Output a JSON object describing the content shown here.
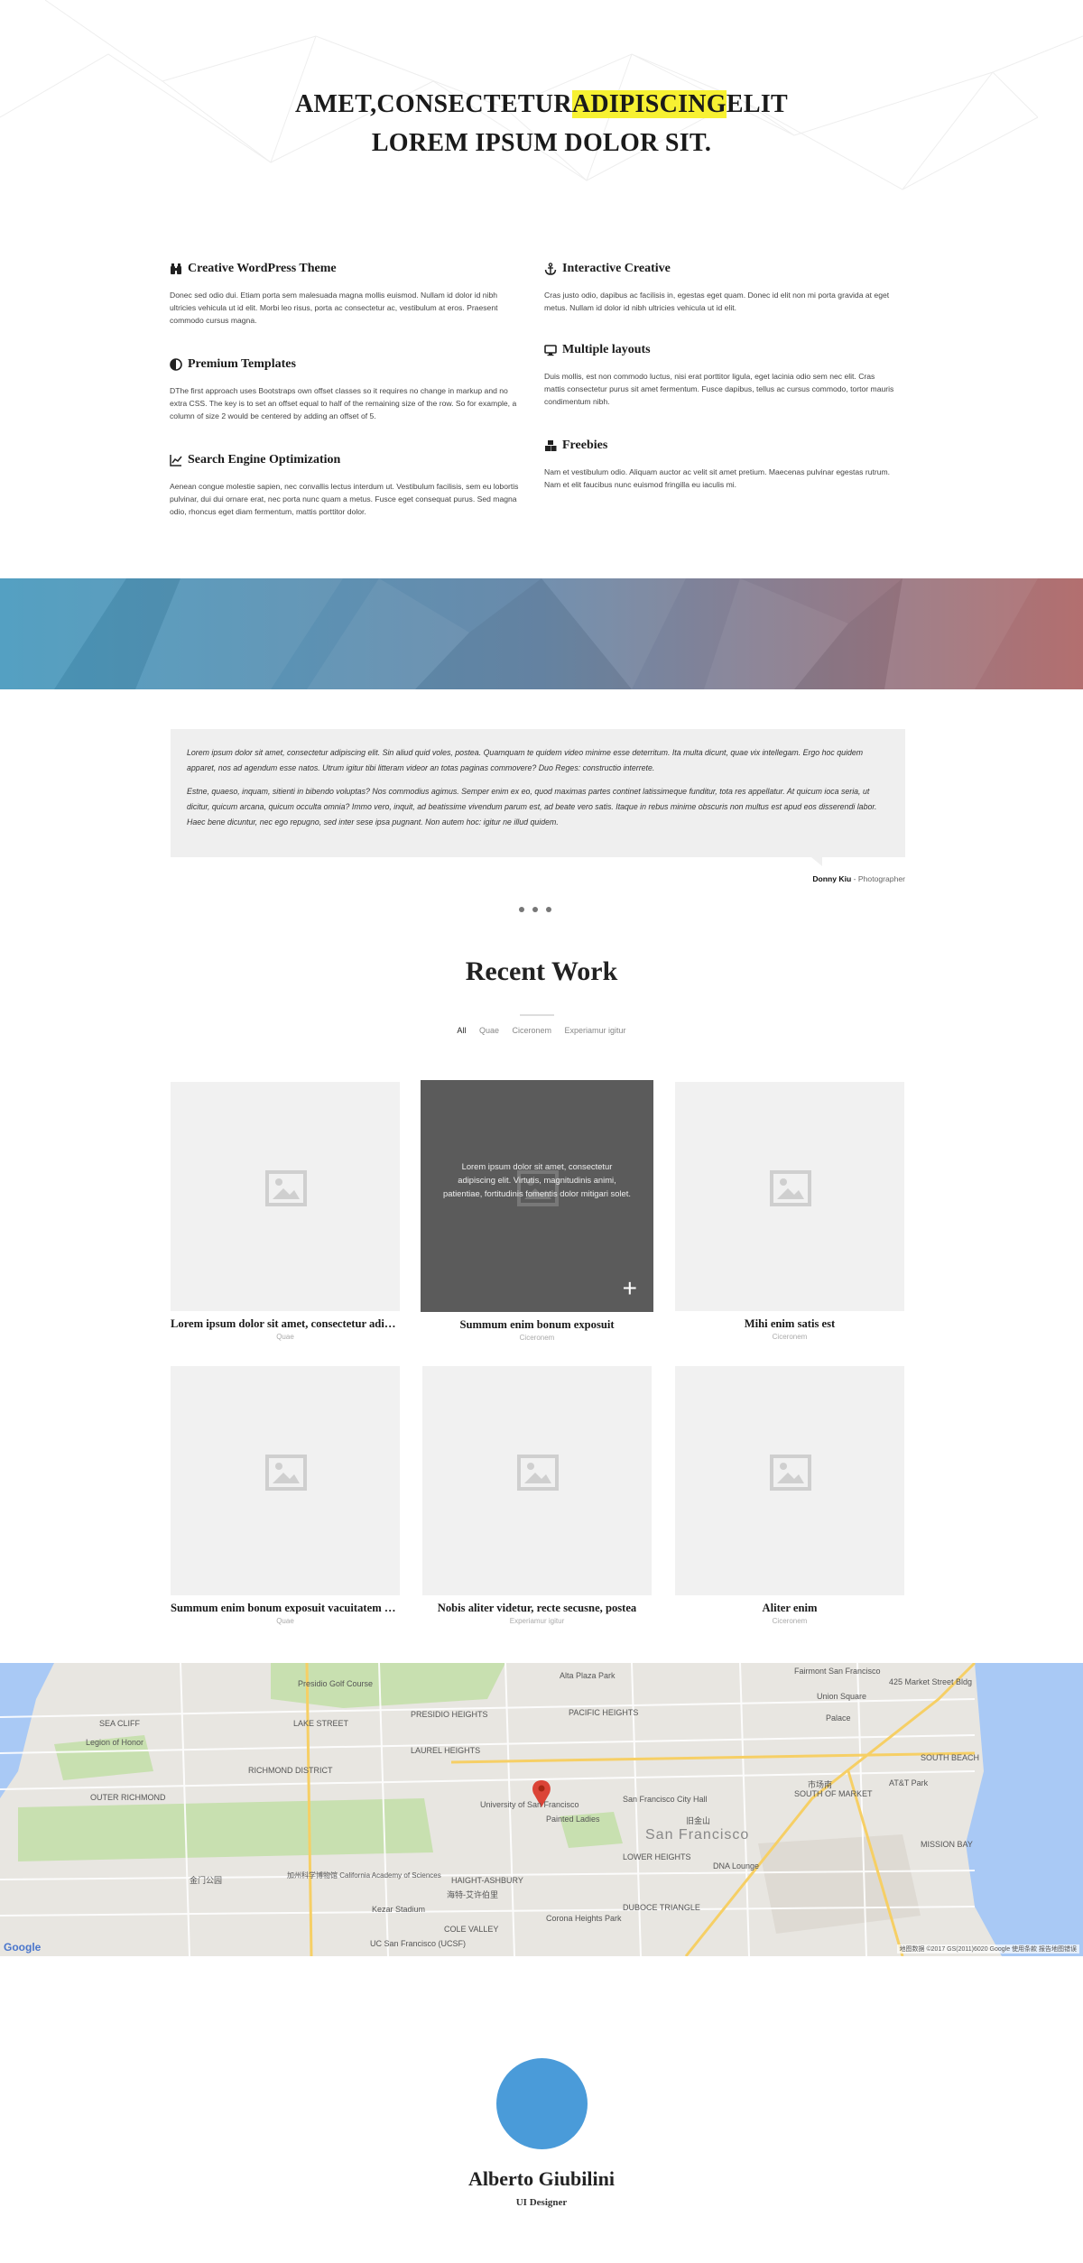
{
  "hero": {
    "line1_pre": "AMET,CONSECTETUR",
    "line1_highlight": "ADIPISCING",
    "line1_post": "ELIT",
    "line2": "LOREM IPSUM DOLOR SIT."
  },
  "features": [
    {
      "icon": "binoculars-icon",
      "title": "Creative WordPress Theme",
      "text": "Donec sed odio dui. Etiam porta sem malesuada magna mollis euismod. Nullam id dolor id nibh ultricies vehicula ut id elit. Morbi leo risus, porta ac consectetur ac, vestibulum at eros. Praesent commodo cursus magna."
    },
    {
      "icon": "adjust-icon",
      "title": "Premium Templates",
      "text": "DThe first approach uses Bootstraps own offset classes so it requires no change in markup and no extra CSS. The key is to set an offset equal to half of the remaining size of the row. So for example, a column of size 2 would be centered by adding an offset of 5."
    },
    {
      "icon": "line-chart-icon",
      "title": "Search Engine Optimization",
      "text": "Aenean congue molestie sapien, nec convallis lectus interdum ut. Vestibulum facilisis, sem eu lobortis pulvinar, dui dui ornare erat, nec porta nunc quam a metus. Fusce eget consequat purus. Sed magna odio, rhoncus eget diam fermentum, mattis porttitor dolor."
    },
    {
      "icon": "anchor-icon",
      "title": "Interactive Creative",
      "text": "Cras justo odio, dapibus ac facilisis in, egestas eget quam. Donec id elit non mi porta gravida at eget metus. Nullam id dolor id nibh ultricies vehicula ut id elit."
    },
    {
      "icon": "desktop-icon",
      "title": "Multiple layouts",
      "text": "Duis mollis, est non commodo luctus, nisi erat porttitor ligula, eget lacinia odio sem nec elit. Cras mattis consectetur purus sit amet fermentum. Fusce dapibus, tellus ac cursus commodo, tortor mauris condimentum nibh."
    },
    {
      "icon": "cubes-icon",
      "title": "Freebies",
      "text": "Nam et vestibulum odio. Aliquam auctor ac velit sit amet pretium. Maecenas pulvinar egestas rutrum. Nam et elit faucibus nunc euismod fringilla eu iaculis mi."
    }
  ],
  "testimonial": {
    "p1": "Lorem ipsum dolor sit amet, consectetur adipiscing elit. Sin aliud quid voles, postea. Quamquam te quidem video minime esse deterritum. Ita multa dicunt, quae vix intellegam. Ergo hoc quidem apparet, nos ad agendum esse natos. Utrum igitur tibi litteram videor an totas paginas commovere? Duo Reges: constructio interrete.",
    "p2": "Estne, quaeso, inquam, sitienti in bibendo voluptas? Nos commodius agimus. Semper enim ex eo, quod maximas partes continet latissimeque funditur, tota res appellatur. At quicum ioca seria, ut dicitur, quicum arcana, quicum occulta omnia? Immo vero, inquit, ad beatissime vivendum parum est, ad beate vero satis. Itaque in rebus minime obscuris non multus est apud eos disserendi labor. Haec bene dicuntur, nec ego repugno, sed inter sese ipsa pugnant. Non autem hoc: igitur ne illud quidem.",
    "author": "Donny Kiu",
    "role": " - Photographer"
  },
  "recent_work": {
    "title": "Recent Work",
    "filters": [
      "All",
      "Quae",
      "Ciceronem",
      "Experiamur igitur"
    ],
    "items": [
      {
        "title": "Lorem ipsum dolor sit amet, consectetur adipiscing",
        "category": "Quae"
      },
      {
        "title": "Summum enim bonum exposuit",
        "category": "Ciceronem",
        "overlay": "Lorem ipsum dolor sit amet, consectetur adipiscing elit. Virtutis, magnitudinis animi, patientiae, fortitudinis fomentis dolor mitigari solet.",
        "plus": "+"
      },
      {
        "title": "Mihi enim satis est",
        "category": "Ciceronem"
      },
      {
        "title": "Summum enim bonum exposuit vacuitatem doloris",
        "category": "Quae"
      },
      {
        "title": "Nobis aliter videtur, recte secusne, postea",
        "category": "Experiamur igitur"
      },
      {
        "title": "Aliter enim",
        "category": "Ciceronem"
      }
    ]
  },
  "map": {
    "labels": [
      "Presidio Golf Course",
      "SEA CLIFF",
      "Legion of Honor",
      "LAKE STREET",
      "RICHMOND DISTRICT",
      "OUTER RICHMOND",
      "PRESIDIO HEIGHTS",
      "LAUREL HEIGHTS",
      "PACIFIC HEIGHTS",
      "Alta Plaza Park",
      "University of San Francisco",
      "Painted Ladies",
      "San Francisco City Hall",
      "HAIGHT-ASHBURY",
      "Kezar Stadium",
      "COLE VALLEY",
      "LOWER HEIGHTS",
      "DUBOCE TRIANGLE",
      "Corona Heights Park",
      "DNA Lounge",
      "SOUTH OF MARKET",
      "AT&T Park",
      "MISSION BAY",
      "SOUTH BEACH",
      "Union Square",
      "Palace",
      "Fairmont San Francisco",
      "425 Market Street Bldg",
      "UC San Francisco (UCSF)",
      "加州科学博物馆 California Academy of Sciences",
      "金门公园",
      "海特-艾许伯里",
      "市场南",
      "旧金山"
    ],
    "city": "San Francisco",
    "google": "Google",
    "attribution": "地图数据 ©2017 GS(2011)6020 Google   使用条款   报告地图错误"
  },
  "profile": {
    "name": "Alberto Giubilini",
    "role": "UI Designer"
  },
  "colors": {
    "highlight": "#f7f132",
    "band_left": "#4a9bbf",
    "band_right": "#b36f6f",
    "avatar": "#4a9bd9",
    "hover_overlay": "#5b5b5b"
  }
}
